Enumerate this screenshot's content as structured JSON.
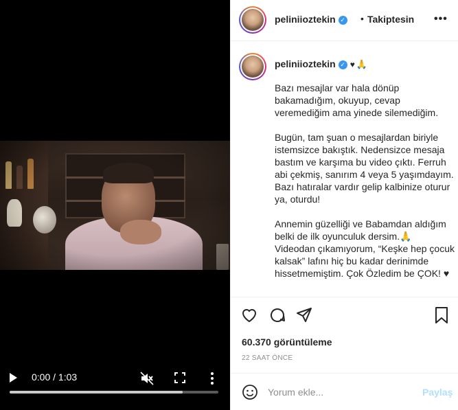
{
  "video": {
    "time_display": "0:00 / 1:03",
    "progress_fraction": 0.83
  },
  "header": {
    "username": "peliniioztekin",
    "separator": "•",
    "follow_label": "Takiptesin",
    "more_label": "•••"
  },
  "caption": {
    "username": "peliniioztekin",
    "emoji_heart": "♥",
    "emoji_pray": "🙏",
    "paragraphs": [
      "Bazı mesajlar var hala dönüp bakamadığım, okuyup, cevap veremediğim ama yinede silemediğim.",
      "Bugün, tam şuan o mesajlardan biriyle istemsizce bakıştık. Nedensizce mesaja bastım ve karşıma bu video çıktı. Ferruh abi çekmiş, sanırım 4 veya 5 yaşımdayım. Bazı hatıralar vardır gelip kalbinize oturur ya, oturdu!",
      "Annemin güzelliği ve Babamdan aldığım belki de ilk oyunculuk dersim.🙏 Videodan çıkamıyorum, “Keşke hep çocuk kalsak” lafını hiç bu kadar derinimde hissetmemiştim. Çok Özledim be ÇOK! ♥"
    ]
  },
  "stats": {
    "views": "60.370 görüntüleme",
    "time_ago": "22 SAAT ÖNCE"
  },
  "comment": {
    "placeholder": "Yorum ekle...",
    "post_label": "Paylaş"
  },
  "colors": {
    "verified": "#3897f0",
    "post_button_disabled": "#b2dffc",
    "muted_text": "#8e8e8e"
  }
}
